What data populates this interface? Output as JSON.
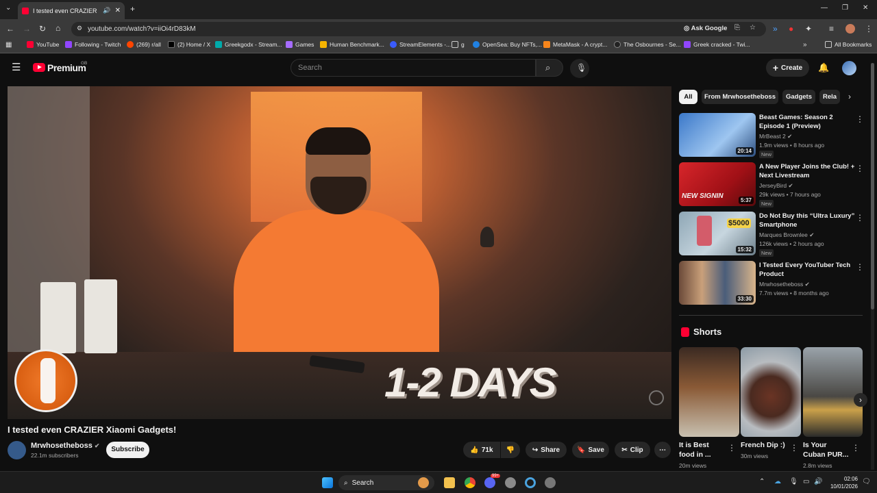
{
  "browser": {
    "tab_title": "I tested even CRAZIER Xiaomi G",
    "url": "youtube.com/watch?v=iiOi4rD83kM",
    "ask_google": "Ask Google",
    "all_bookmarks": "All Bookmarks",
    "bookmarks": [
      "YouTube",
      "Following - Twitch",
      "(269) r/all",
      "(2) Home / X",
      "Greekgodx - Stream...",
      "Games",
      "Human Benchmark...",
      "StreamElements -...",
      "g",
      "OpenSea: Buy NFTs,...",
      "MetaMask - A crypt...",
      "The Osbournes - Se...",
      "Greek cracked - Twi..."
    ]
  },
  "header": {
    "logo": "Premium",
    "region": "GB",
    "search_placeholder": "Search",
    "create_label": "Create"
  },
  "video": {
    "overlay_text": "1-2 DAYS",
    "title": "I tested even CRAZIER Xiaomi Gadgets!",
    "channel": "Mrwhosetheboss",
    "subscribers": "22.1m subscribers",
    "subscribe_label": "Subscribe",
    "likes": "71k",
    "share_label": "Share",
    "save_label": "Save",
    "clip_label": "Clip"
  },
  "sidebar": {
    "chips": [
      "All",
      "From Mrwhosetheboss",
      "Gadgets",
      "Rela"
    ],
    "recs": [
      {
        "title": "Beast Games: Season 2 Episode 1 (Preview)",
        "channel": "MrBeast 2",
        "meta": "1.9m views • 8 hours ago",
        "badge": "New",
        "duration": "20:14"
      },
      {
        "title": "A New Player Joins the Club! + Next Livestream Announceme...",
        "channel": "JerseyBird",
        "meta": "29k views • 7 hours ago",
        "badge": "New",
        "duration": "5:37",
        "thumb_text": "NEW SIGNIN"
      },
      {
        "title": "Do Not Buy this “Ultra Luxury” Smartphone",
        "channel": "Marques Brownlee",
        "meta": "126k views • 2 hours ago",
        "badge": "New",
        "duration": "15:32",
        "thumb_text": "$5000"
      },
      {
        "title": "I Tested Every YouTuber Tech Product",
        "channel": "Mrwhosetheboss",
        "meta": "7.7m views • 8 months ago",
        "badge": "",
        "duration": "33:30"
      }
    ],
    "shorts_heading": "Shorts",
    "shorts": [
      {
        "title": "It is Best food in ...",
        "views": "20m views"
      },
      {
        "title": "French Dip :)",
        "views": "30m views"
      },
      {
        "title": "Is Your Cuban PUR...",
        "views": "2.8m views"
      }
    ]
  },
  "taskbar": {
    "search_label": "Search",
    "time": "02:06",
    "date": "10/01/2026",
    "badge": "99+"
  },
  "colors": {
    "accent": "#ff0033",
    "background": "#0f0f0f"
  }
}
